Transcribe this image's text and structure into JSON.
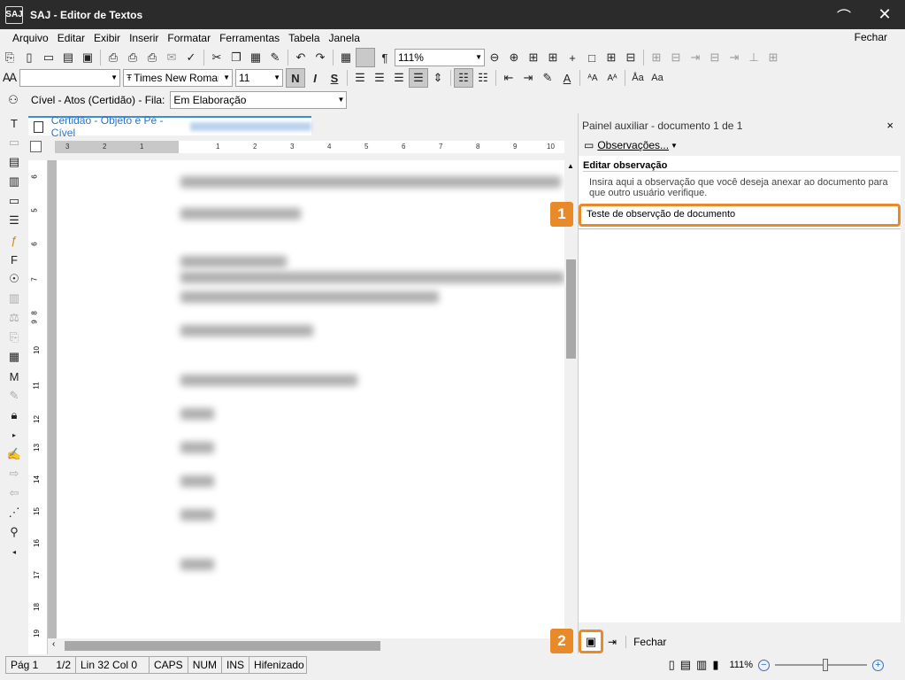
{
  "window": {
    "title": "SAJ - Editor de Textos",
    "app_icon": "SAJ"
  },
  "menu": {
    "items": [
      "Arquivo",
      "Editar",
      "Exibir",
      "Inserir",
      "Formatar",
      "Ferramentas",
      "Tabela",
      "Janela"
    ],
    "right_action": "Fechar"
  },
  "toolbar": {
    "zoom_value": "111%",
    "font_name": "Times New Roman",
    "font_size": "11",
    "bold": "N",
    "italic": "I",
    "underline": "S",
    "pilcrow": "¶"
  },
  "context_bar": {
    "label": "Cível - Atos (Certidão) - Fila:",
    "queue_value": "Em Elaboração"
  },
  "document": {
    "tab_label": "Certidão - Objeto e Pé - Cível"
  },
  "ruler": {
    "h_numbers": [
      "3",
      "2",
      "1",
      "1",
      "2",
      "3",
      "4",
      "5",
      "6",
      "7",
      "8",
      "9",
      "10"
    ],
    "v_numbers": [
      "6",
      "5",
      "6",
      "7",
      "8",
      "9",
      "10",
      "11",
      "12",
      "13",
      "14",
      "15",
      "16",
      "17",
      "18",
      "19"
    ]
  },
  "panel": {
    "title": "Painel auxiliar - documento 1 de 1",
    "close_glyph": "×",
    "observacoes_label": "Observações...",
    "section_title": "Editar observação",
    "help_text": "Insira aqui a observação que você deseja anexar ao documento para que outro usuário verifique.",
    "observation_value": "Teste de observção de documento",
    "footer_close": "Fechar"
  },
  "badges": {
    "one": "1",
    "two": "2"
  },
  "accent_color": "#e8892a",
  "statusbar": {
    "page": "Pág 1",
    "page_count": "1/2",
    "line_col": "Lin 32  Col 0",
    "caps": "CAPS",
    "num": "NUM",
    "ins": "INS",
    "hyphen": "Hifenizado",
    "zoom": "111%"
  }
}
